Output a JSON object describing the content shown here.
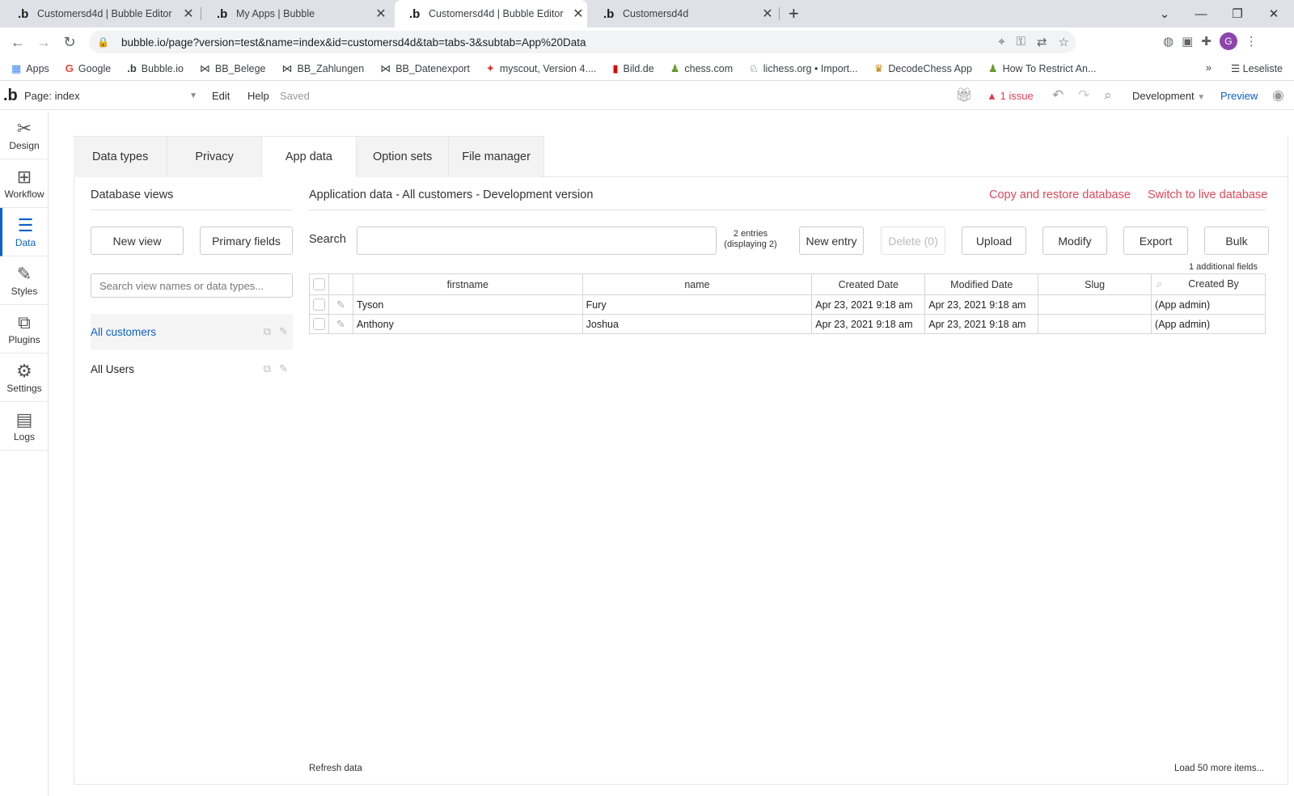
{
  "browser": {
    "tabs": [
      {
        "title": "Customersd4d | Bubble Editor",
        "favicon": "bubble-icon"
      },
      {
        "title": "My Apps | Bubble",
        "favicon": "bubble-icon"
      },
      {
        "title": "Customersd4d | Bubble Editor",
        "favicon": "bubble-icon",
        "active": true
      },
      {
        "title": "Customersd4d",
        "favicon": "bubble-icon"
      }
    ],
    "url": "bubble.io/page?version=test&name=index&id=customersd4d&tab=tabs-3&subtab=App%20Data",
    "profile_initial": "G",
    "bookmarks": [
      "Apps",
      "Google",
      "Bubble.io",
      "BB_Belege",
      "BB_Zahlungen",
      "BB_Datenexport",
      "myscout, Version 4....",
      "Bild.de",
      "chess.com",
      "lichess.org • Import...",
      "DecodeChess App",
      "How To Restrict An..."
    ],
    "reading_list": "Leseliste",
    "more_bookmarks": "»"
  },
  "editor": {
    "page_label": "Page: index",
    "menu": {
      "edit": "Edit",
      "help": "Help",
      "saved": "Saved"
    },
    "issues": "1 issue",
    "environment": "Development",
    "preview": "Preview",
    "accent_color": "#0d61c8",
    "alert_color": "#e03e52"
  },
  "sidebar": {
    "items": [
      {
        "label": "Design",
        "icon": "design-icon"
      },
      {
        "label": "Workflow",
        "icon": "workflow-icon"
      },
      {
        "label": "Data",
        "icon": "database-icon",
        "active": true
      },
      {
        "label": "Styles",
        "icon": "brush-icon"
      },
      {
        "label": "Plugins",
        "icon": "plugin-icon"
      },
      {
        "label": "Settings",
        "icon": "gear-icon"
      },
      {
        "label": "Logs",
        "icon": "document-icon"
      }
    ]
  },
  "data_tabs": [
    "Data types",
    "Privacy",
    "App data",
    "Option sets",
    "File manager"
  ],
  "db_views": {
    "title": "Database views",
    "new_view": "New view",
    "primary_fields": "Primary fields",
    "search_placeholder": "Search view names or data types...",
    "views": [
      "All customers",
      "All Users"
    ]
  },
  "app_data": {
    "title": "Application data - All customers - Development version",
    "copy_restore": "Copy and restore database",
    "switch_live": "Switch to live database",
    "search_label": "Search",
    "entries_line1": "2 entries",
    "entries_line2": "(displaying 2)",
    "buttons": {
      "new_entry": "New entry",
      "delete": "Delete (0)",
      "upload": "Upload",
      "modify": "Modify",
      "export": "Export",
      "bulk": "Bulk"
    },
    "additional_fields": "1 additional fields",
    "columns": [
      "firstname",
      "name",
      "Created Date",
      "Modified Date",
      "Slug",
      "Created By"
    ],
    "rows": [
      [
        "Tyson",
        "Fury",
        "Apr 23, 2021 9:18 am",
        "Apr 23, 2021 9:18 am",
        "",
        "(App admin)"
      ],
      [
        "Anthony",
        "Joshua",
        "Apr 23, 2021 9:18 am",
        "Apr 23, 2021 9:18 am",
        "",
        "(App admin)"
      ]
    ],
    "refresh": "Refresh data",
    "load_more": "Load 50 more items..."
  }
}
